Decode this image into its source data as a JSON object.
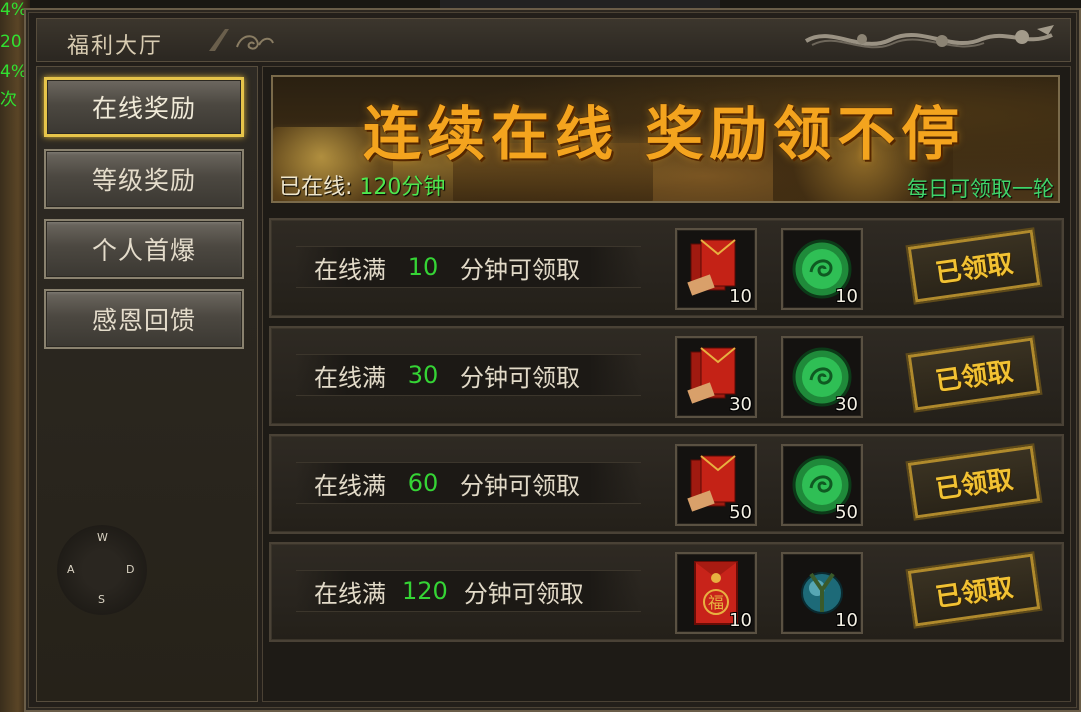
{
  "hud": {
    "stats": [
      "4%",
      "20",
      "4%",
      "次"
    ]
  },
  "window": {
    "title": "福利大厅"
  },
  "sidebar": {
    "items": [
      {
        "label": "在线奖励",
        "active": true
      },
      {
        "label": "等级奖励",
        "active": false
      },
      {
        "label": "个人首爆",
        "active": false
      },
      {
        "label": "感恩回馈",
        "active": false
      }
    ],
    "compass": {
      "n": "W",
      "w": "A",
      "e": "D",
      "s": "S"
    }
  },
  "banner": {
    "title": "连续在线  奖励领不停",
    "online_label": "已在线:",
    "online_value": "120分钟",
    "daily_note": "每日可领取一轮"
  },
  "rewards": [
    {
      "prefix": "在线满",
      "minutes": "10",
      "suffix": "分钟可领取",
      "item1_icon": "red-envelope-stack-icon",
      "item1_count": "10",
      "item2_icon": "jade-dragon-orb-icon",
      "item2_count": "10",
      "status": "已领取"
    },
    {
      "prefix": "在线满",
      "minutes": "30",
      "suffix": "分钟可领取",
      "item1_icon": "red-envelope-stack-icon",
      "item1_count": "30",
      "item2_icon": "jade-dragon-orb-icon",
      "item2_count": "30",
      "status": "已领取"
    },
    {
      "prefix": "在线满",
      "minutes": "60",
      "suffix": "分钟可领取",
      "item1_icon": "red-envelope-stack-icon",
      "item1_count": "50",
      "item2_icon": "jade-dragon-orb-icon",
      "item2_count": "50",
      "status": "已领取"
    },
    {
      "prefix": "在线满",
      "minutes": "120",
      "suffix": "分钟可领取",
      "item1_icon": "fu-red-envelope-icon",
      "item1_count": "10",
      "item2_icon": "crystal-orb-icon",
      "item2_count": "10",
      "status": "已领取"
    }
  ],
  "colors": {
    "accent_gold": "#e6c44a",
    "value_green": "#35d435",
    "claimed_text": "#f2c233"
  }
}
